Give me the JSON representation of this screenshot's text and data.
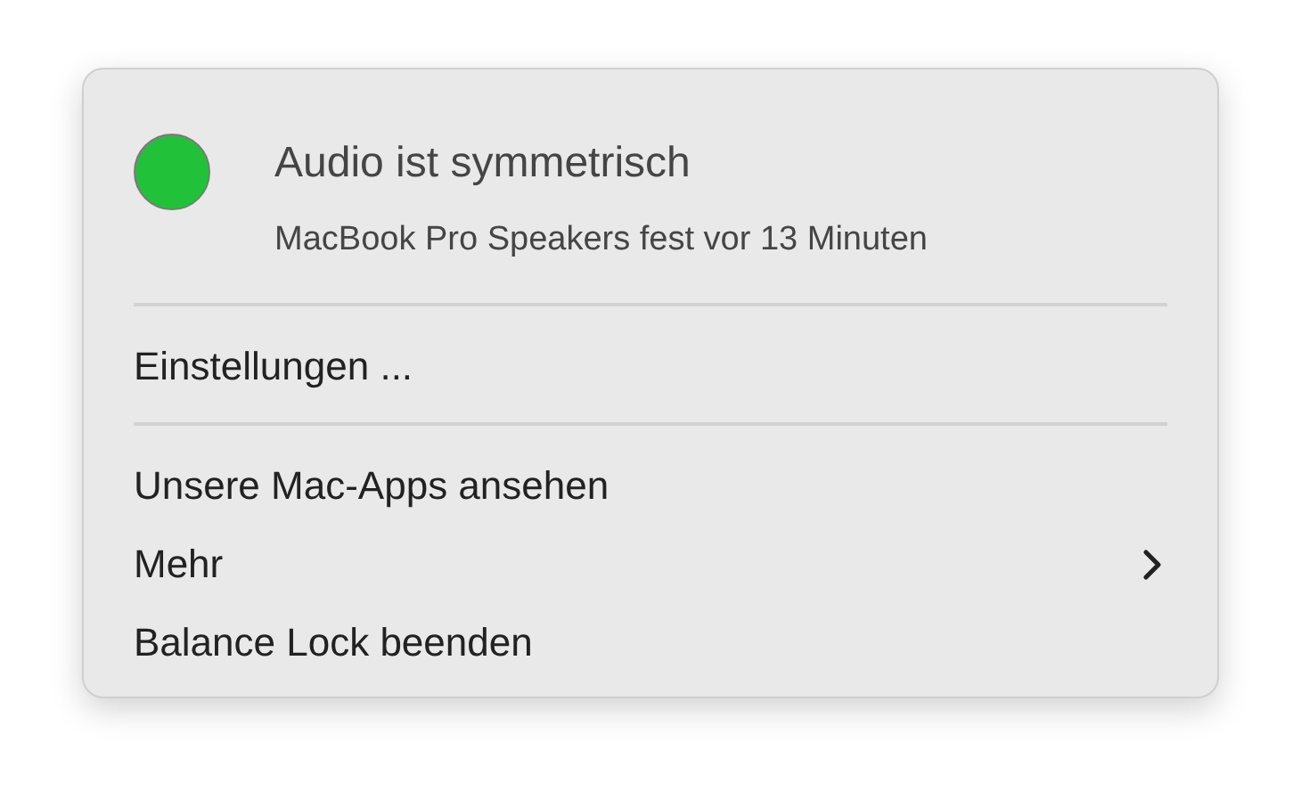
{
  "status": {
    "color": "#22c13a",
    "title": "Audio ist symmetrisch",
    "subtitle": "MacBook Pro Speakers fest vor 13 Minuten"
  },
  "sections": [
    {
      "items": [
        {
          "label": "Einstellungen ...",
          "submenu": false
        }
      ]
    },
    {
      "items": [
        {
          "label": "Unsere Mac-Apps ansehen",
          "submenu": false
        },
        {
          "label": "Mehr",
          "submenu": true
        },
        {
          "label": "Balance Lock beenden",
          "submenu": false
        }
      ]
    }
  ]
}
